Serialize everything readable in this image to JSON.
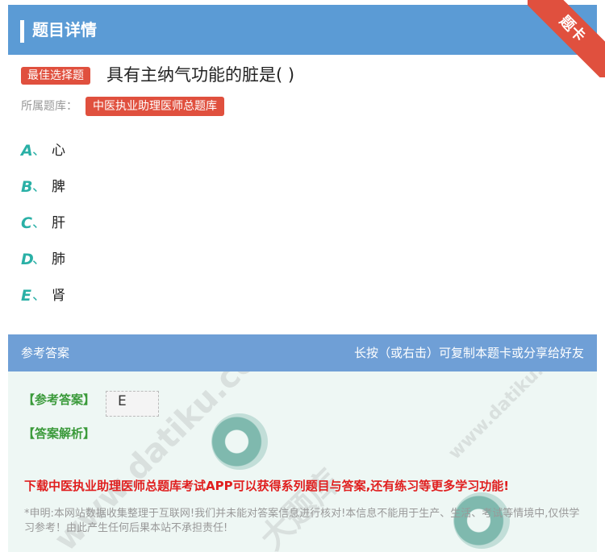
{
  "header": {
    "title": "题目详情",
    "ribbon": "题卡"
  },
  "question": {
    "tag": "最佳选择题",
    "text": "具有主纳气功能的脏是( )"
  },
  "bank": {
    "label": "所属题库：",
    "name": "中医执业助理医师总题库"
  },
  "options": [
    {
      "letter": "A",
      "sep": "、",
      "text": "心"
    },
    {
      "letter": "B",
      "sep": "、",
      "text": "脾"
    },
    {
      "letter": "C",
      "sep": "、",
      "text": "肝"
    },
    {
      "letter": "D",
      "sep": "、",
      "text": "肺"
    },
    {
      "letter": "E",
      "sep": "、",
      "text": "肾"
    }
  ],
  "answer_section": {
    "title": "参考答案",
    "hint": "长按（或右击）可复制本题卡或分享给好友",
    "answer_label": "【参考答案】",
    "answer_value": "E",
    "analysis_label": "【答案解析】",
    "promo": "下载中医执业助理医师总题库考试APP可以获得系列题目与答案,还有练习等更多学习功能!",
    "disclaimer": "*申明:本网站数据收集整理于互联网!我们并未能对答案信息进行核对!本信息不能用于生产、生活、考试等情境中,仅供学习参考！由此产生任何后果本站不承担责任!"
  },
  "watermark": {
    "text": "大题库",
    "url": "www.datiku.com"
  },
  "colors": {
    "header_bg": "#5b9bd5",
    "tag_red": "#e0503e",
    "option_teal": "#2ab0a6",
    "answer_green": "#3a9a3a",
    "promo_red": "#e01e1e"
  }
}
